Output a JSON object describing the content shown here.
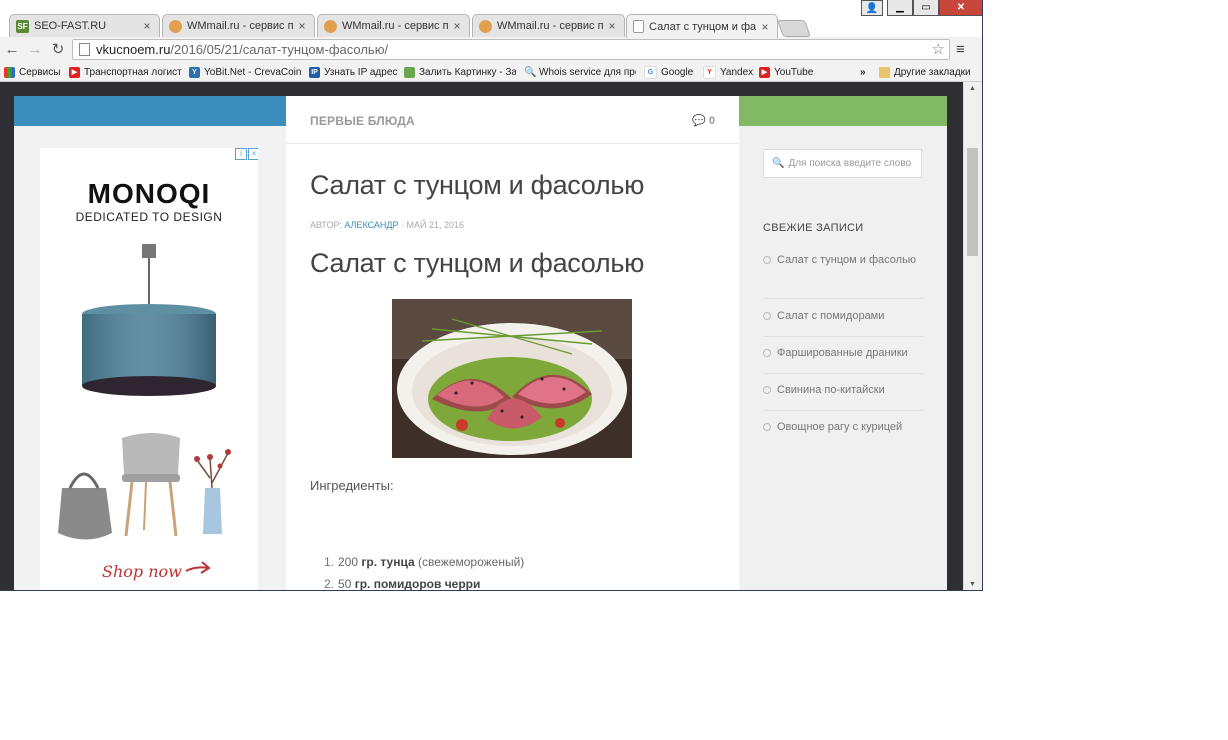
{
  "browser": {
    "tabs": [
      {
        "title": "SEO-FAST.RU",
        "icon": "seofast-icon",
        "active": false
      },
      {
        "title": "WMmail.ru - сервис почт",
        "icon": "wmmail-icon",
        "active": false
      },
      {
        "title": "WMmail.ru - сервис почт",
        "icon": "wmmail-icon",
        "active": false
      },
      {
        "title": "WMmail.ru - сервис почт",
        "icon": "wmmail-icon",
        "active": false
      },
      {
        "title": "Салат с тунцом и фасол",
        "icon": "page-icon",
        "active": true
      }
    ],
    "url_host": "vkucnoem.ru",
    "url_path": "/2016/05/21/салат-тунцом-фасолью/",
    "bookmarks": [
      {
        "label": "Сервисы",
        "icon": "apps-grid-icon"
      },
      {
        "label": "Транспортная логист",
        "icon": "youtube-icon"
      },
      {
        "label": "YoBit.Net - CrevaCoin",
        "icon": "yobit-icon"
      },
      {
        "label": "Узнать IP адрес",
        "icon": "ip-icon"
      },
      {
        "label": "Залить Картинку - За",
        "icon": "image-icon"
      },
      {
        "label": "Whois service для про",
        "icon": "search-icon"
      },
      {
        "label": "Google",
        "icon": "google-icon"
      },
      {
        "label": "Yandex",
        "icon": "yandex-icon"
      },
      {
        "label": "YouTube",
        "icon": "youtube-icon"
      },
      {
        "label": "»",
        "icon": "overflow-chevron-icon"
      },
      {
        "label": "Другие закладки",
        "icon": "folder-icon"
      }
    ]
  },
  "ad": {
    "brand": "MONOQI",
    "tagline": "DEDICATED TO DESIGN",
    "cta": "Shop now"
  },
  "article": {
    "category": "ПЕРВЫЕ БЛЮДА",
    "comments_count": "0",
    "title": "Салат с тунцом и фасолью",
    "meta_prefix": "АВТОР:",
    "author": "АЛЕКСАНДР",
    "date": "МАЙ 21, 2016",
    "heading": "Салат с тунцом и фасолью",
    "ingredients_label": "Ингредиенты:",
    "ingredients": [
      {
        "num": "1.",
        "qty": "200",
        "bold": "гр. тунца",
        "rest": "(свежемороженый)"
      },
      {
        "num": "2.",
        "qty": "50",
        "bold": "гр. помидоров черри",
        "rest": ""
      }
    ]
  },
  "sidebar": {
    "search_placeholder": "Для поиска введите слово",
    "recent_heading": "СВЕЖИЕ ЗАПИСИ",
    "recent": [
      "Салат с тунцом и фасолью",
      "Салат с помидорами",
      "Фаршированные драники",
      "Свинина по-китайски",
      "Овощное рагу с курицей"
    ]
  },
  "colors": {
    "accent_blue": "#3b8dbd",
    "accent_green": "#82b965",
    "dark_bg": "#2f2f33"
  }
}
